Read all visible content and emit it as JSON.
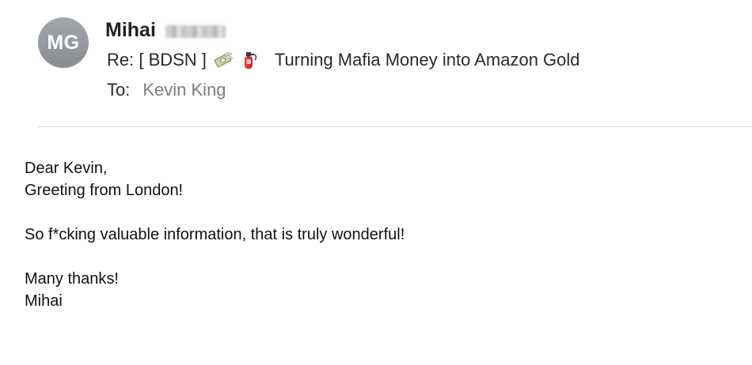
{
  "header": {
    "avatar_initials": "MG",
    "sender_name": "Mihai",
    "subject_prefix": "Re: [ BDSN ]",
    "subject_icons": [
      "money-with-wings-icon",
      "fire-extinguisher-icon"
    ],
    "subject_text": "Turning Mafia Money into Amazon Gold",
    "to_label": "To:",
    "to_value": "Kevin King"
  },
  "body": {
    "greeting": "Dear Kevin,",
    "line_intro": "Greeting from London!",
    "line_main": "So f*cking valuable information, that is truly wonderful!",
    "line_thanks": "Many thanks!",
    "signature": "Mihai"
  },
  "colors": {
    "avatar_bg": "#979a9f",
    "recipient_text": "#7d7d7d",
    "divider": "#dcdcdc"
  }
}
